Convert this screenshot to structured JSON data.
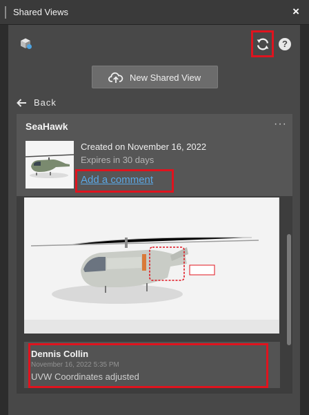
{
  "window": {
    "title": "Shared Views",
    "close_glyph": "×"
  },
  "toolbar": {
    "cube_icon": "cube-share-icon",
    "refresh_icon": "refresh-icon",
    "help_glyph": "?"
  },
  "new_share_button": {
    "label": "New Shared View",
    "icon": "cloud-upload-icon"
  },
  "back": {
    "label": "Back",
    "icon": "arrow-left-icon"
  },
  "shared_view": {
    "title": "SeaHawk",
    "more_glyph": "···",
    "created": "Created on November 16, 2022",
    "expires": "Expires in 30 days",
    "add_comment": "Add a comment"
  },
  "comment": {
    "author": "Dennis Collin",
    "timestamp": "November 16, 2022 5:35 PM",
    "text": "UVW Coordinates adjusted"
  },
  "colors": {
    "highlight": "#e0131e",
    "link": "#5aa8e6",
    "panel": "#484848",
    "card_header": "#565656"
  }
}
